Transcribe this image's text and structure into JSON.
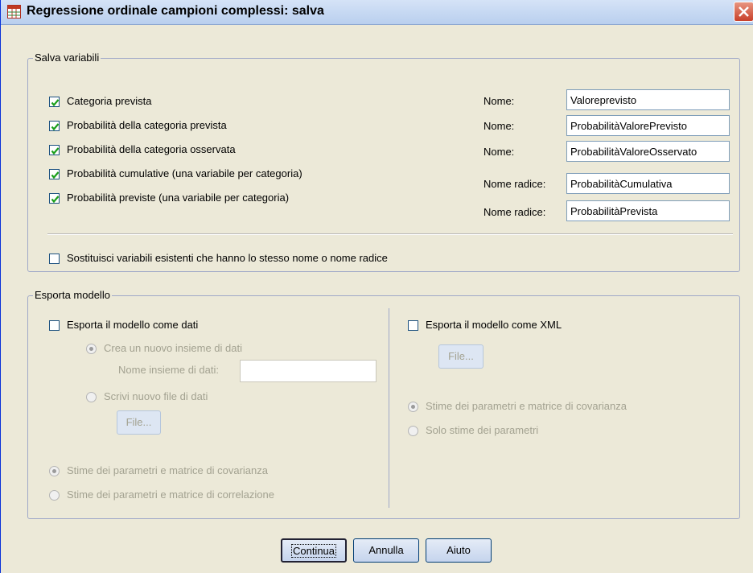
{
  "window": {
    "title": "Regressione ordinale campioni complessi: salva"
  },
  "save_variables": {
    "legend": "Salva variabili",
    "items": [
      {
        "label": "Categoria prevista",
        "checked": true,
        "field_label": "Nome:",
        "field_value": "Valoreprevisto"
      },
      {
        "label": "Probabilità della categoria prevista",
        "checked": true,
        "field_label": "Nome:",
        "field_value": "ProbabilitàValorePrevisto"
      },
      {
        "label": "Probabilità della categoria osservata",
        "checked": true,
        "field_label": "Nome:",
        "field_value": "ProbabilitàValoreOsservato"
      },
      {
        "label": "Probabilità cumulative (una variabile per categoria)",
        "checked": true,
        "field_label": "Nome radice:",
        "field_value": "ProbabilitàCumulativa"
      },
      {
        "label": "Probabilità previste (una variabile per categoria)",
        "checked": true,
        "field_label": "Nome radice:",
        "field_value": "ProbabilitàPrevista"
      }
    ],
    "replace": {
      "label": "Sostituisci variabili esistenti che hanno lo stesso nome o nome radice",
      "checked": false
    }
  },
  "export_model": {
    "legend": "Esporta modello",
    "as_data": {
      "label": "Esporta il modello come dati",
      "checked": false,
      "new_dataset_radio": "Crea un nuovo insieme di dati",
      "dataset_name_label": "Nome insieme di dati:",
      "dataset_name_value": "",
      "new_file_radio": "Scrivi nuovo file di dati",
      "file_button": "File...",
      "cov_radio": "Stime dei parametri e matrice di covarianza",
      "corr_radio": "Stime dei parametri e matrice di correlazione"
    },
    "as_xml": {
      "label": "Esporta il modello come XML",
      "checked": false,
      "file_button": "File...",
      "cov_radio": "Stime dei parametri e matrice di covarianza",
      "params_radio": "Solo stime dei parametri"
    }
  },
  "buttons": {
    "continue": "Continua",
    "cancel": "Annulla",
    "help": "Aiuto"
  },
  "colors": {
    "dialog_bg": "#ece9d8",
    "check_green": "#1b9f1b",
    "disabled_text": "#a3a291"
  }
}
